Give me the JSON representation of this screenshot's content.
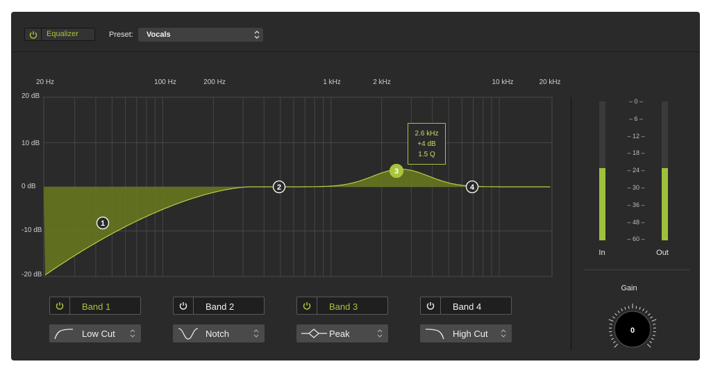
{
  "toolbar": {
    "plugin_label": "Equalizer",
    "preset_label": "Preset:",
    "preset_value": "Vocals"
  },
  "frequency_axis": [
    "20 Hz",
    "100 Hz",
    "200 Hz",
    "1 kHz",
    "2 kHz",
    "10 kHz",
    "20 kHz"
  ],
  "gain_axis": [
    "20 dB",
    "10 dB",
    "0 dB",
    "-10 dB",
    "-20 dB"
  ],
  "nodes": [
    {
      "id": "1",
      "freq_hz": 50,
      "gain_db": -8,
      "selected": false
    },
    {
      "id": "2",
      "freq_hz": 400,
      "gain_db": 0,
      "selected": false
    },
    {
      "id": "3",
      "freq_hz": 2600,
      "gain_db": 4,
      "selected": true
    },
    {
      "id": "4",
      "freq_hz": 6300,
      "gain_db": 0,
      "selected": false
    }
  ],
  "tooltip": {
    "freq": "2.6 kHz",
    "gain": "+4 dB",
    "q": "1.5 Q"
  },
  "bands": [
    {
      "label": "Band 1",
      "enabled": true,
      "type": "Low Cut",
      "icon": "low-cut-icon"
    },
    {
      "label": "Band 2",
      "enabled": false,
      "type": "Notch",
      "icon": "notch-icon"
    },
    {
      "label": "Band 3",
      "enabled": true,
      "type": "Peak",
      "icon": "peak-icon"
    },
    {
      "label": "Band 4",
      "enabled": false,
      "type": "High Cut",
      "icon": "high-cut-icon"
    }
  ],
  "meters": {
    "scale": [
      "0",
      "6",
      "12",
      "18",
      "24",
      "30",
      "36",
      "48",
      "60"
    ],
    "in_label": "In",
    "out_label": "Out",
    "in_level": 0.52,
    "out_level": 0.52
  },
  "gain": {
    "label": "Gain",
    "value": "0"
  },
  "colors": {
    "accent": "#a8c43a",
    "fill": "#6a7a1e",
    "background": "#2a2a2a"
  }
}
